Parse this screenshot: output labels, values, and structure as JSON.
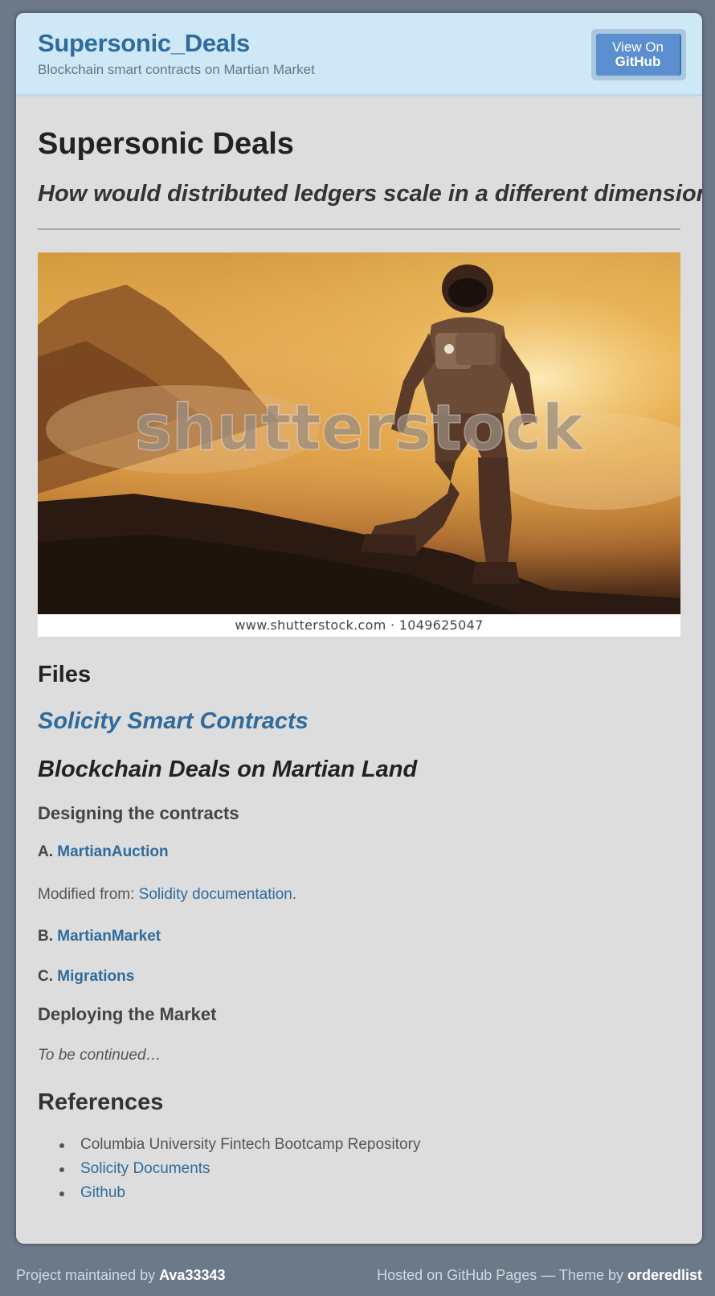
{
  "header": {
    "title": "Supersonic_Deals",
    "tagline": "Blockchain smart contracts on Martian Market",
    "github_button": {
      "line1": "View On",
      "line2": "GitHub"
    }
  },
  "main": {
    "page_title": "Supersonic Deals",
    "question": "How would distributed ledgers scale in a different dimension?",
    "hero_image": {
      "watermark": "shutterstock",
      "caption": "www.shutterstock.com · 1049625047"
    },
    "files_heading": "Files",
    "solicity_heading": "Solicity Smart Contracts",
    "martian_heading": "Blockchain Deals on Martian Land",
    "designing_heading": "Designing the contracts",
    "contracts": [
      {
        "prefix": "A.",
        "label": "MartianAuction"
      },
      {
        "prefix": "B.",
        "label": "MartianMarket"
      },
      {
        "prefix": "C.",
        "label": "Migrations"
      }
    ],
    "modified_from": {
      "text": "Modified from: ",
      "link": "Solidity documentation",
      "suffix": "."
    },
    "deploying_heading": "Deploying the Market",
    "to_be_continued": "To be continued…",
    "references_heading": "References",
    "references": [
      {
        "label": "Columbia University Fintech Bootcamp Repository",
        "is_link": false
      },
      {
        "label": "Solicity Documents",
        "is_link": true
      },
      {
        "label": "Github",
        "is_link": true
      }
    ]
  },
  "footer": {
    "left_text": "Project maintained by ",
    "maintainer": "Ava33343",
    "right_text": "Hosted on GitHub Pages — Theme by ",
    "theme": "orderedlist"
  },
  "colors": {
    "page_background": "#6c7989",
    "content_background": "#dddddd",
    "header_background": "#cfe8f6",
    "link": "#2f6b9c",
    "button": "#5b8fcf"
  }
}
